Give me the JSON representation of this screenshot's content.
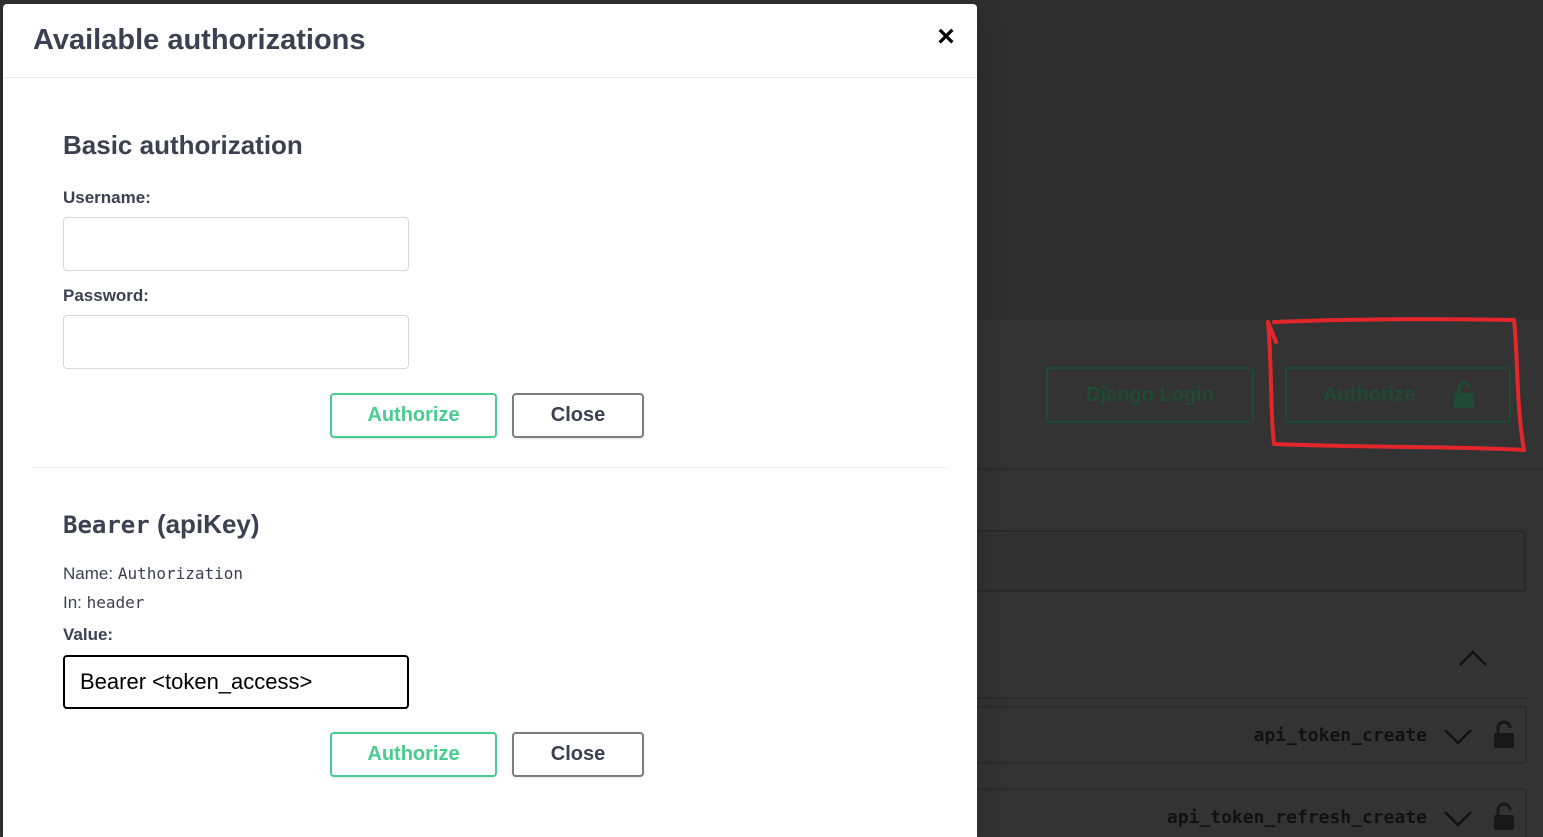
{
  "background": {
    "django_login_label": "Django Login",
    "authorize_label": "Authorize",
    "operations": [
      {
        "name": "api_token_create"
      },
      {
        "name": "api_token_refresh_create"
      }
    ]
  },
  "modal": {
    "title": "Available authorizations",
    "close_symbol": "×",
    "basic": {
      "title": "Basic authorization",
      "username_label": "Username:",
      "username_value": "",
      "password_label": "Password:",
      "password_value": "",
      "authorize_label": "Authorize",
      "close_label": "Close"
    },
    "bearer": {
      "title_name": "Bearer",
      "title_type": "(apiKey)",
      "name_label": "Name:",
      "name_value": "Authorization",
      "in_label": "In:",
      "in_value": "header",
      "value_label": "Value:",
      "value": "Bearer <token_access>",
      "authorize_label": "Authorize",
      "close_label": "Close"
    }
  },
  "colors": {
    "authorize_accent": "#49cc90",
    "annotation_red": "#e3262b",
    "overlay": "#2f2f2f"
  }
}
